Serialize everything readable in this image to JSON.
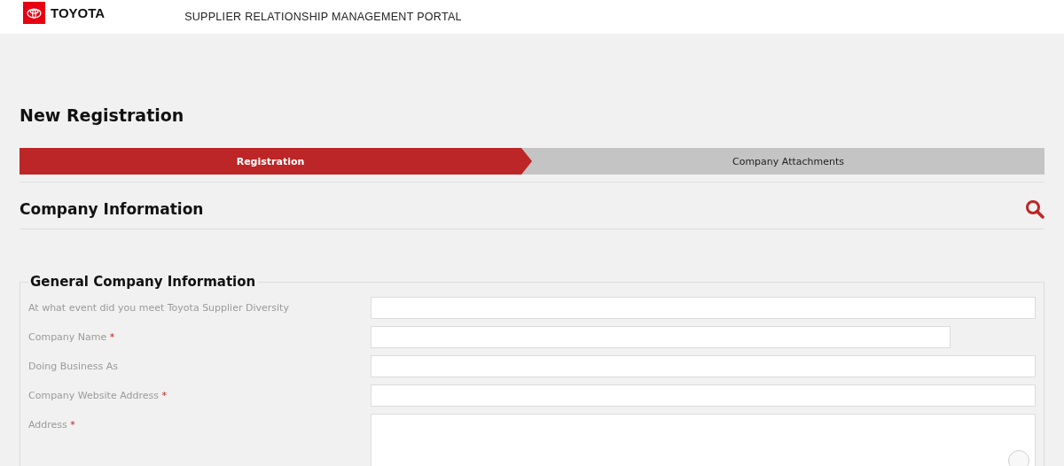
{
  "header": {
    "brand": "TOYOTA",
    "portal_title": "SUPPLIER RELATIONSHIP MANAGEMENT PORTAL"
  },
  "page_title": "New Registration",
  "steps": [
    {
      "label": "Registration",
      "selected": true
    },
    {
      "label": "Company Attachments",
      "selected": false
    }
  ],
  "section": {
    "title": "Company Information"
  },
  "fieldset": {
    "legend": "General Company Information",
    "fields": [
      {
        "label": "At what event did you meet Toyota Supplier Diversity",
        "kind": "text"
      },
      {
        "label": "Company Name",
        "required_mark": "*",
        "kind": "short"
      },
      {
        "label": "Doing Business As",
        "kind": "text"
      },
      {
        "label": "Company Website Address",
        "required_mark": "*",
        "kind": "text"
      },
      {
        "label": "Address",
        "required_mark": "*",
        "kind": "textarea"
      }
    ]
  }
}
